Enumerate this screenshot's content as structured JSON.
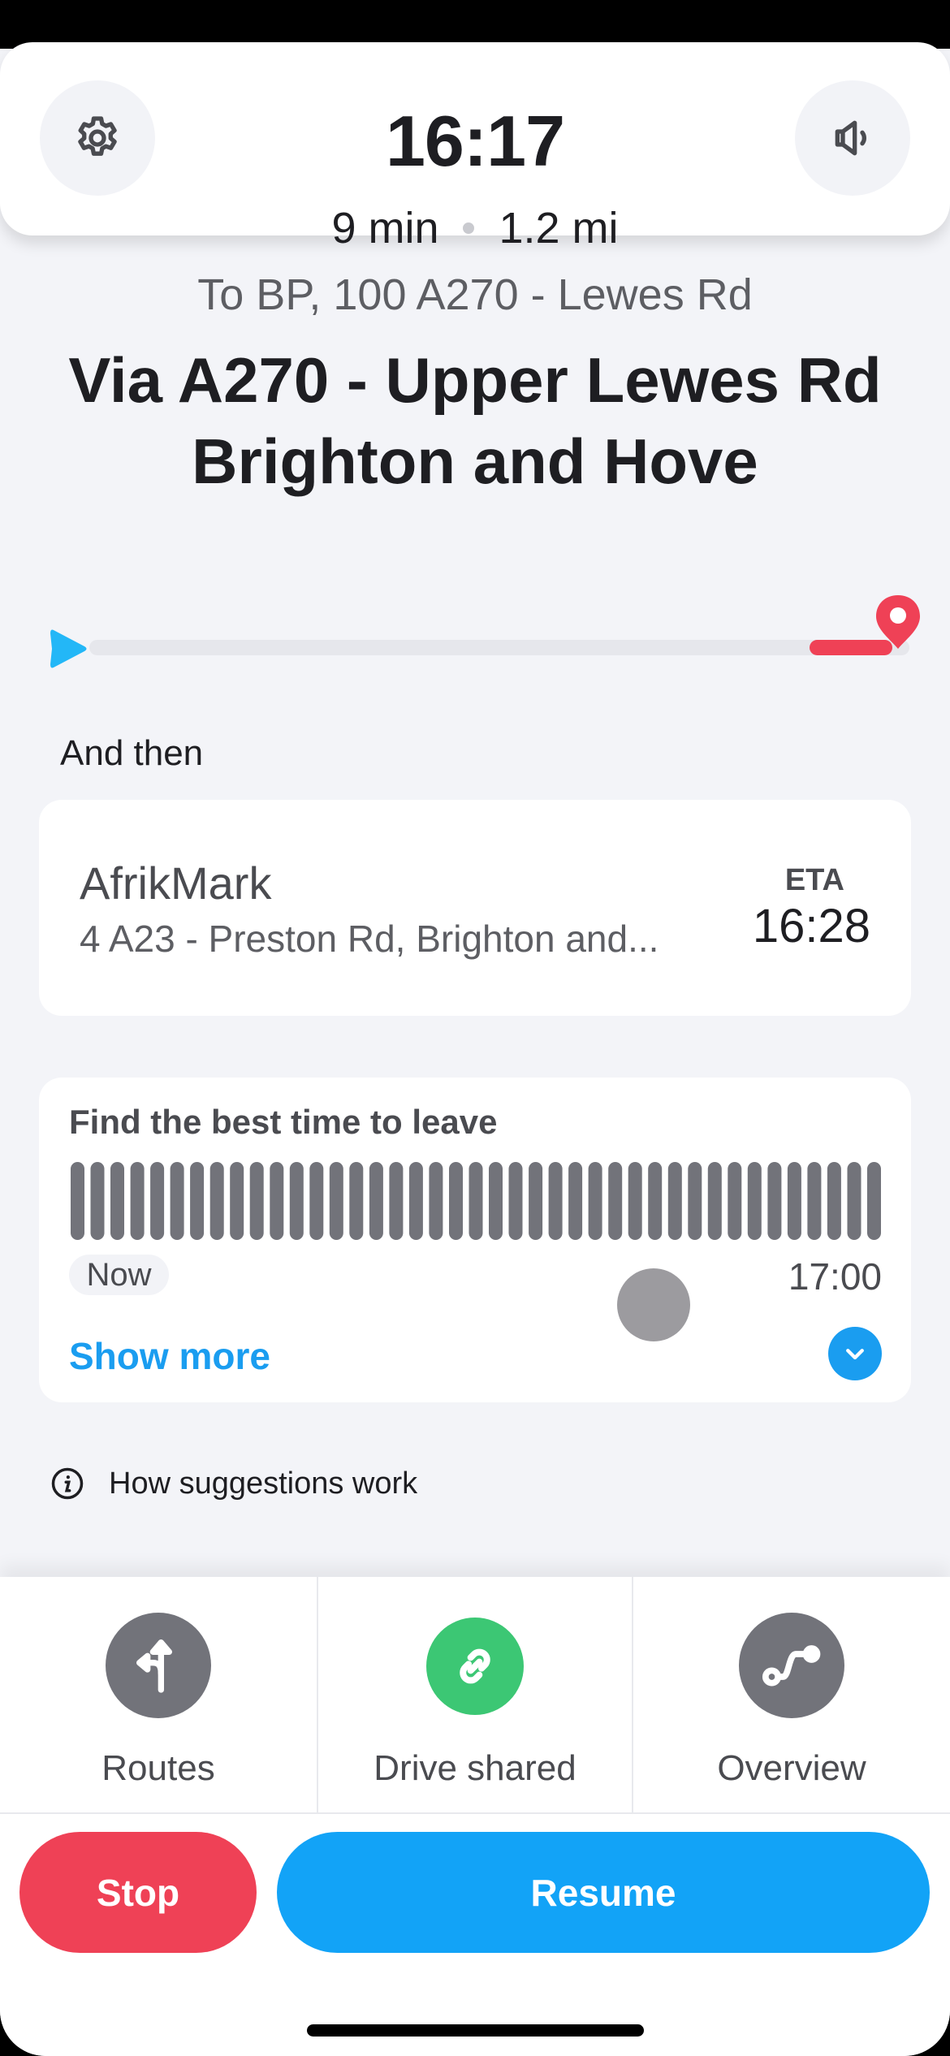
{
  "header": {
    "eta_time": "16:17",
    "duration": "9 min",
    "distance": "1.2 mi",
    "settings_icon": "gear-icon",
    "sound_icon": "speaker-icon"
  },
  "route": {
    "destination_line": "To BP, 100 A270 - Lewes Rd",
    "via_line1": "Via A270 - Upper Lewes Rd",
    "via_line2": "Brighton and Hove",
    "progress_fraction": 0.0
  },
  "next_stop": {
    "section_label": "And then",
    "name": "AfrikMark",
    "address": "4 A23 - Preston Rd, Brighton and...",
    "eta_label": "ETA",
    "eta": "16:28"
  },
  "best_time": {
    "title": "Find the best time to leave",
    "bar_count": 41,
    "start_label": "Now",
    "end_label": "17:00",
    "show_more": "Show more"
  },
  "info": {
    "text": "How suggestions work"
  },
  "actions": [
    {
      "label": "Routes",
      "icon": "routes-icon",
      "color": "#72737a"
    },
    {
      "label": "Drive shared",
      "icon": "link-icon",
      "color": "#3cc774"
    },
    {
      "label": "Overview",
      "icon": "route-overview-icon",
      "color": "#72737a"
    }
  ],
  "buttons": {
    "stop": "Stop",
    "resume": "Resume"
  },
  "colors": {
    "accent_blue": "#1a9df0",
    "stop_red": "#ef4156",
    "green": "#3cc774",
    "icon_gray": "#72737a"
  }
}
